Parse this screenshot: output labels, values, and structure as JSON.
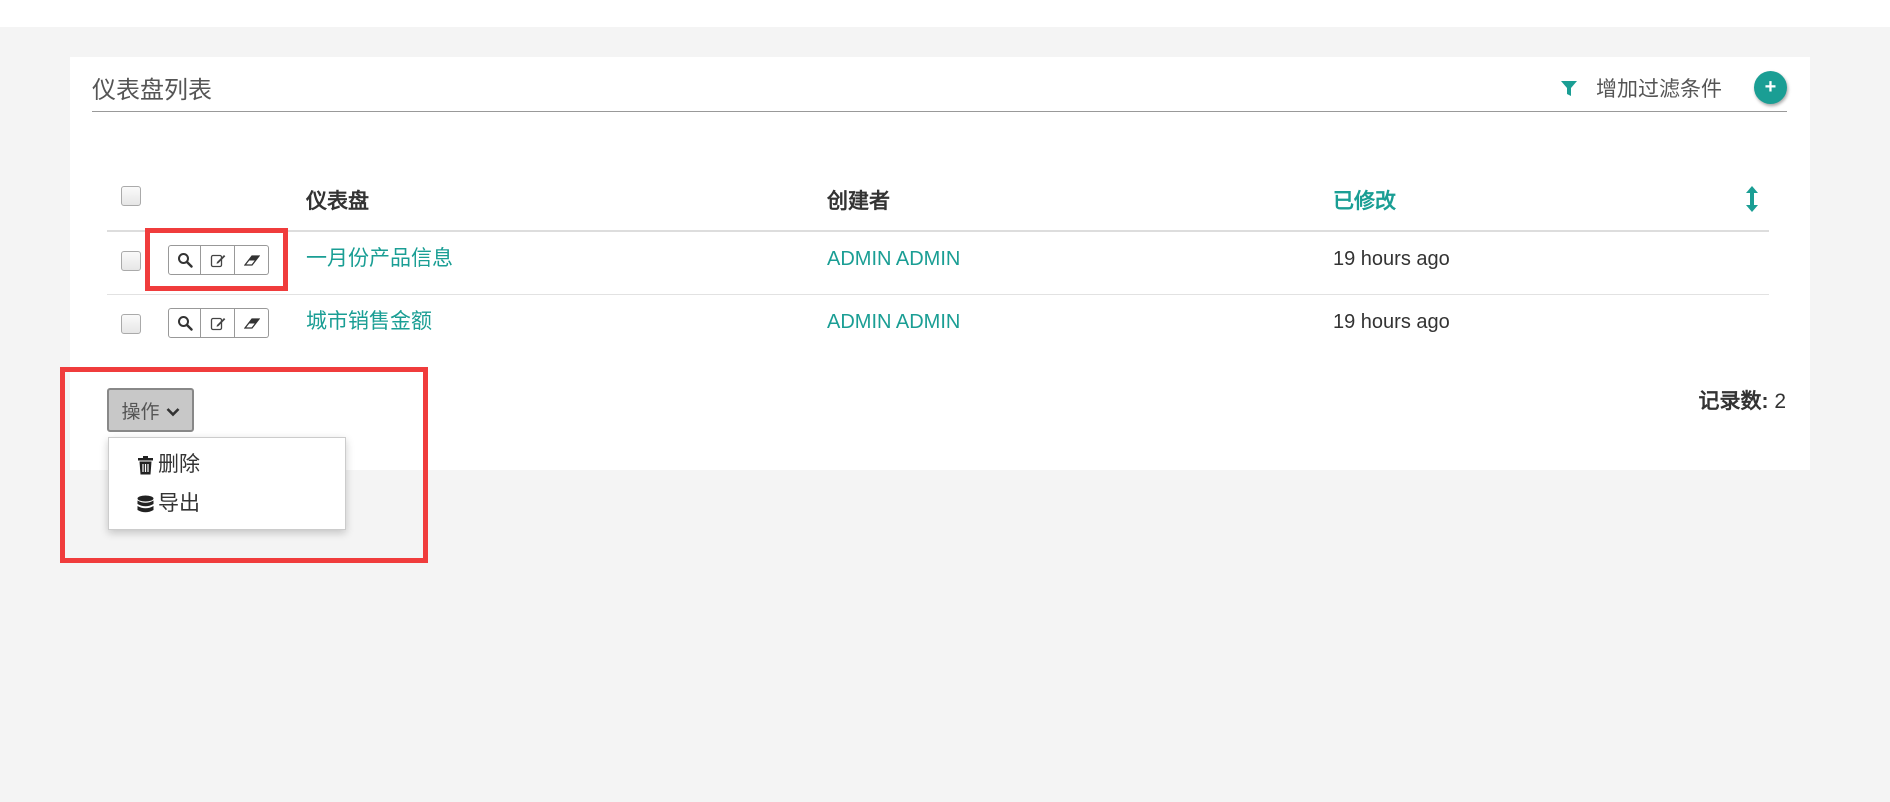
{
  "panel": {
    "title": "仪表盘列表",
    "filter_label": "增加过滤条件",
    "add_button_symbol": "+"
  },
  "table": {
    "columns": [
      "仪表盘",
      "创建者",
      "已修改"
    ],
    "rows": [
      {
        "name": "一月份产品信息",
        "creator": "ADMIN ADMIN",
        "modified": "19 hours ago"
      },
      {
        "name": "城市销售金额",
        "creator": "ADMIN ADMIN",
        "modified": "19 hours ago"
      }
    ],
    "row_action_icons": [
      "search-icon",
      "edit-icon",
      "eraser-icon"
    ]
  },
  "actions": {
    "button_label": "操作",
    "menu": [
      {
        "icon": "trash-icon",
        "label": "删除"
      },
      {
        "icon": "database-icon",
        "label": "导出"
      }
    ]
  },
  "footer": {
    "count_label": "记录数:",
    "count_value": "2"
  },
  "colors": {
    "accent": "#1a9e94",
    "highlight_box": "#f03c3c",
    "background": "#f4f4f4"
  }
}
